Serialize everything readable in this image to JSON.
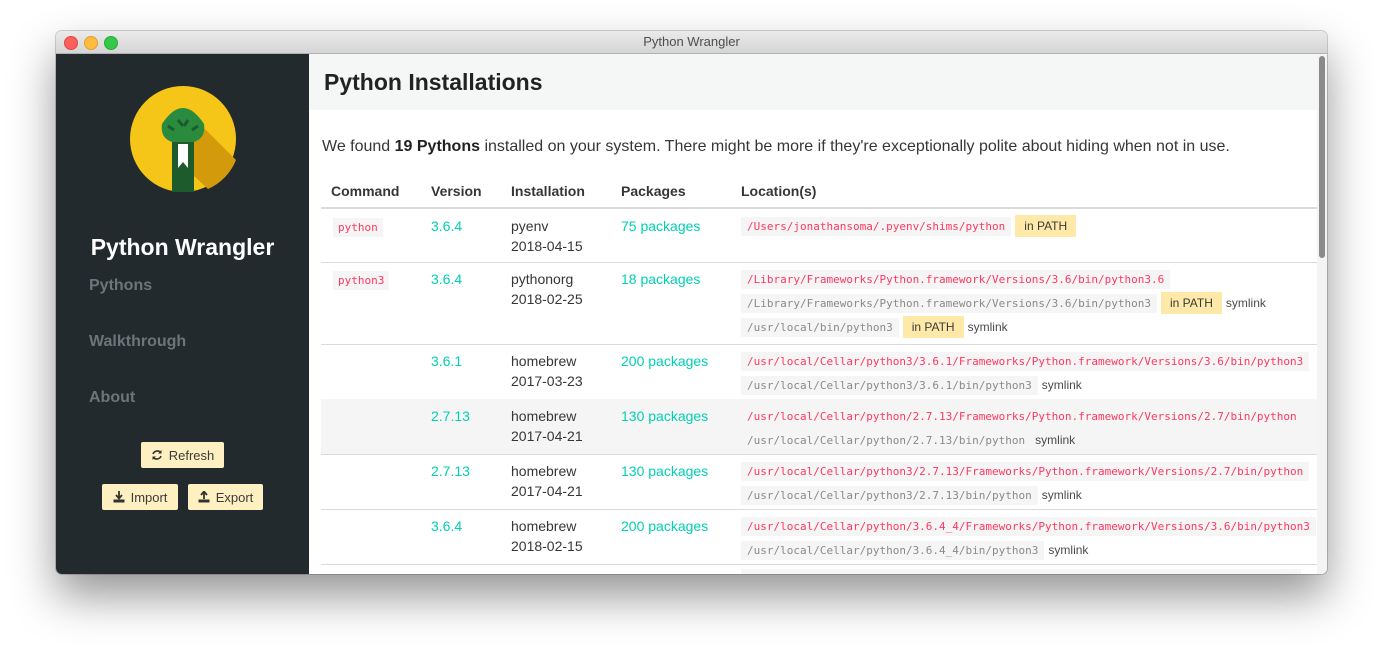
{
  "window": {
    "title": "Python Wrangler"
  },
  "sidebar": {
    "app_name": "Python Wrangler",
    "nav": [
      "Pythons",
      "Walkthrough",
      "About"
    ],
    "refresh_label": "Refresh",
    "import_label": "Import",
    "export_label": "Export"
  },
  "main": {
    "title": "Python Installations",
    "summary_prefix": "We found ",
    "summary_count": "19 Pythons",
    "summary_suffix": " installed on your system. There might be more if they're exceptionally polite about hiding when not in use.",
    "columns": [
      "Command",
      "Version",
      "Installation",
      "Packages",
      "Location(s)"
    ],
    "rows": [
      {
        "command": "python",
        "version": "3.6.4",
        "installer": "pyenv",
        "date": "2018-04-15",
        "packages": "75 packages",
        "locations": [
          {
            "path": "/Users/jonathansoma/.pyenv/shims/python",
            "primary": true,
            "in_path": "in PATH",
            "symlink": ""
          }
        ]
      },
      {
        "command": "python3",
        "version": "3.6.4",
        "installer": "pythonorg",
        "date": "2018-02-25",
        "packages": "18 packages",
        "locations": [
          {
            "path": "/Library/Frameworks/Python.framework/Versions/3.6/bin/python3.6",
            "primary": true,
            "in_path": "",
            "symlink": ""
          },
          {
            "path": "/Library/Frameworks/Python.framework/Versions/3.6/bin/python3",
            "primary": false,
            "in_path": "in PATH",
            "symlink": "symlink"
          },
          {
            "path": "/usr/local/bin/python3",
            "primary": false,
            "in_path": "in PATH",
            "symlink": "symlink"
          }
        ]
      },
      {
        "command": "",
        "version": "3.6.1",
        "installer": "homebrew",
        "date": "2017-03-23",
        "packages": "200 packages",
        "locations": [
          {
            "path": "/usr/local/Cellar/python3/3.6.1/Frameworks/Python.framework/Versions/3.6/bin/python3",
            "primary": true,
            "in_path": "",
            "symlink": ""
          },
          {
            "path": "/usr/local/Cellar/python3/3.6.1/bin/python3",
            "primary": false,
            "in_path": "",
            "symlink": "symlink"
          }
        ]
      },
      {
        "command": "",
        "version": "2.7.13",
        "installer": "homebrew",
        "date": "2017-04-21",
        "packages": "130 packages",
        "locations": [
          {
            "path": "/usr/local/Cellar/python/2.7.13/Frameworks/Python.framework/Versions/2.7/bin/python",
            "primary": true,
            "in_path": "",
            "symlink": ""
          },
          {
            "path": "/usr/local/Cellar/python/2.7.13/bin/python",
            "primary": false,
            "in_path": "",
            "symlink": "symlink"
          }
        ]
      },
      {
        "command": "",
        "version": "2.7.13",
        "installer": "homebrew",
        "date": "2017-04-21",
        "packages": "130 packages",
        "locations": [
          {
            "path": "/usr/local/Cellar/python3/2.7.13/Frameworks/Python.framework/Versions/2.7/bin/python",
            "primary": true,
            "in_path": "",
            "symlink": ""
          },
          {
            "path": "/usr/local/Cellar/python3/2.7.13/bin/python",
            "primary": false,
            "in_path": "",
            "symlink": "symlink"
          }
        ]
      },
      {
        "command": "",
        "version": "3.6.4",
        "installer": "homebrew",
        "date": "2018-02-15",
        "packages": "200 packages",
        "locations": [
          {
            "path": "/usr/local/Cellar/python/3.6.4_4/Frameworks/Python.framework/Versions/3.6/bin/python3",
            "primary": true,
            "in_path": "",
            "symlink": ""
          },
          {
            "path": "/usr/local/Cellar/python/3.6.4_4/bin/python3",
            "primary": false,
            "in_path": "",
            "symlink": "symlink"
          }
        ]
      }
    ]
  },
  "colors": {
    "sidebar_bg": "#222a2d",
    "accent_teal": "#00d1b2",
    "packages_green": "#23d160",
    "command_red": "#ff3860",
    "button_yellow": "#fff0c1",
    "in_path_badge": "#ffe9a8"
  }
}
